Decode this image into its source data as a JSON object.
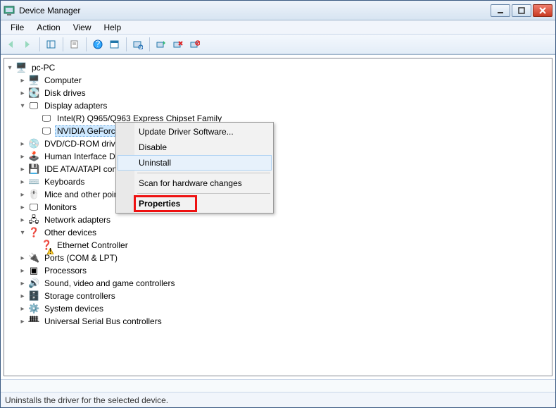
{
  "window": {
    "title": "Device Manager"
  },
  "menubar": {
    "items": [
      "File",
      "Action",
      "View",
      "Help"
    ]
  },
  "toolbar": {
    "buttons": [
      {
        "name": "back-icon",
        "interact": true,
        "disabled": true
      },
      {
        "name": "forward-icon",
        "interact": true,
        "disabled": true
      },
      {
        "sep": true
      },
      {
        "name": "show-hide-console-tree-icon",
        "interact": true
      },
      {
        "sep": true
      },
      {
        "name": "properties-icon",
        "interact": true
      },
      {
        "sep": true
      },
      {
        "name": "help-icon",
        "interact": true
      },
      {
        "name": "calendar-icon",
        "interact": true
      },
      {
        "sep": true
      },
      {
        "name": "scan-hardware-icon",
        "interact": true
      },
      {
        "sep": true
      },
      {
        "name": "update-driver-icon",
        "interact": true
      },
      {
        "name": "uninstall-icon",
        "interact": true
      },
      {
        "name": "disable-icon",
        "interact": true
      }
    ]
  },
  "tree": {
    "root": {
      "label": "pc-PC",
      "icon": "computer-root-icon",
      "expanded": true,
      "children": [
        {
          "label": "Computer",
          "icon": "computer-icon",
          "expandable": true
        },
        {
          "label": "Disk drives",
          "icon": "disk-icon",
          "expandable": true
        },
        {
          "label": "Display adapters",
          "icon": "display-adapter-icon",
          "expandable": true,
          "expanded": true,
          "children": [
            {
              "label": "Intel(R)  Q965/Q963 Express Chipset Family",
              "icon": "display-adapter-icon"
            },
            {
              "label": "NVIDIA GeForce",
              "icon": "display-adapter-icon",
              "selected": true,
              "truncated": true
            }
          ]
        },
        {
          "label": "DVD/CD-ROM drives",
          "icon": "optical-drive-icon",
          "expandable": true,
          "truncated": true
        },
        {
          "label": "Human Interface Devices",
          "icon": "hid-icon",
          "expandable": true,
          "truncated": true
        },
        {
          "label": "IDE ATA/ATAPI controllers",
          "icon": "ide-icon",
          "expandable": true,
          "truncated": true
        },
        {
          "label": "Keyboards",
          "icon": "keyboard-icon",
          "expandable": true
        },
        {
          "label": "Mice and other pointing devices",
          "icon": "mouse-icon",
          "expandable": true,
          "truncated": true
        },
        {
          "label": "Monitors",
          "icon": "monitor-icon",
          "expandable": true
        },
        {
          "label": "Network adapters",
          "icon": "network-icon",
          "expandable": true
        },
        {
          "label": "Other devices",
          "icon": "other-devices-icon",
          "expandable": true,
          "expanded": true,
          "children": [
            {
              "label": "Ethernet Controller",
              "icon": "unknown-device-icon",
              "warn": true
            }
          ]
        },
        {
          "label": "Ports (COM & LPT)",
          "icon": "ports-icon",
          "expandable": true
        },
        {
          "label": "Processors",
          "icon": "processor-icon",
          "expandable": true
        },
        {
          "label": "Sound, video and game controllers",
          "icon": "sound-icon",
          "expandable": true
        },
        {
          "label": "Storage controllers",
          "icon": "storage-icon",
          "expandable": true
        },
        {
          "label": "System devices",
          "icon": "system-icon",
          "expandable": true
        },
        {
          "label": "Universal Serial Bus controllers",
          "icon": "usb-icon",
          "expandable": true
        }
      ]
    }
  },
  "context_menu": {
    "items": [
      {
        "label": "Update Driver Software...",
        "name": "ctx-update-driver"
      },
      {
        "label": "Disable",
        "name": "ctx-disable"
      },
      {
        "label": "Uninstall",
        "name": "ctx-uninstall",
        "hover": true
      },
      {
        "sep": true
      },
      {
        "label": "Scan for hardware changes",
        "name": "ctx-scan"
      },
      {
        "sep": true
      },
      {
        "label": "Properties",
        "name": "ctx-properties",
        "bold": true,
        "highlight": true
      }
    ]
  },
  "statusbar": {
    "text": "Uninstalls the driver for the selected device."
  },
  "icon_glyphs": {
    "computer-root-icon": "🖥️",
    "computer-icon": "🖥️",
    "disk-icon": "💽",
    "display-adapter-icon": "🖵",
    "optical-drive-icon": "💿",
    "hid-icon": "🕹️",
    "ide-icon": "💾",
    "keyboard-icon": "⌨️",
    "mouse-icon": "🖱️",
    "monitor-icon": "🖵",
    "network-icon": "🖧",
    "other-devices-icon": "❓",
    "unknown-device-icon": "❓",
    "ports-icon": "🔌",
    "processor-icon": "▣",
    "sound-icon": "🔊",
    "storage-icon": "🗄️",
    "system-icon": "⚙️",
    "usb-icon": "ᚙ"
  }
}
